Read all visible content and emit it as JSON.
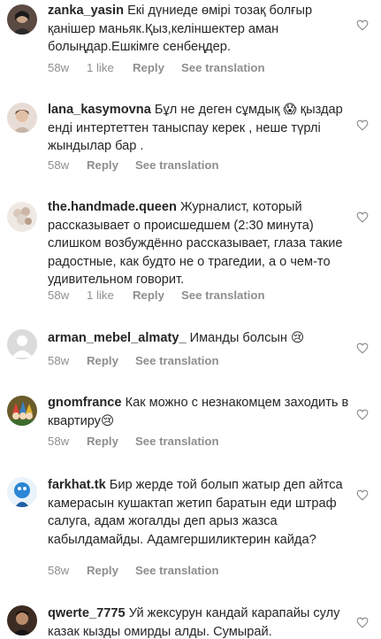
{
  "comments": [
    {
      "username": "zanka_yasin",
      "text": "Екі дүниеде өмірі тозақ болғыр қанішер маньяк.Қыз,келіншектер аман болыңдар.Ешкімге сенбеңдер.",
      "time": "58w",
      "likes": "1 like",
      "reply": "Reply",
      "translation": "See translation",
      "avatar": "avatar-woman-dark-hair"
    },
    {
      "username": "lana_kasymovna",
      "text": "Бұл не деген сұмдық 😱 қыздар енді интертеттен таныспау керек , неше түрлі жындылар бар .",
      "time": "58w",
      "likes": "",
      "reply": "Reply",
      "translation": "See translation",
      "avatar": "avatar-woman-light"
    },
    {
      "username": "the.handmade.queen",
      "text": "Журналист, который рассказывает о происшедшем (2:30 минута) слишком возбуждённо рассказывает, глаза такие радостные, как будто не о трагедии, а о чем-то удивительном говорит.",
      "time": "58w",
      "likes": "1 like",
      "reply": "Reply",
      "translation": "See translation",
      "avatar": "avatar-handmade-flowers"
    },
    {
      "username": "arman_mebel_almaty_",
      "text": "Иманды болсын 😢",
      "time": "58w",
      "likes": "",
      "reply": "Reply",
      "translation": "See translation",
      "avatar": "avatar-default-gray"
    },
    {
      "username": "gnomfrance",
      "text": "Как можно с незнакомцем заходить в квартиру😢",
      "time": "58w",
      "likes": "",
      "reply": "Reply",
      "translation": "See translation",
      "avatar": "avatar-gnomes"
    },
    {
      "username": "farkhat.tk",
      "text": "Бир жерде той болып жатыр деп айтса камерасын кушактап жетип баратын еди штраф салуга, адам жогалды деп арыз жазса кабылдамайды. Адамгершиликтерин кайда?",
      "time": "58w",
      "likes": "",
      "reply": "Reply",
      "translation": "See translation",
      "avatar": "avatar-blue-character"
    },
    {
      "username": "qwerte_7775",
      "text": "Уй жексурун кандай карапайы сулу казак кызды омирды алды. Сумырай.",
      "time": "",
      "likes": "",
      "reply": "",
      "translation": "",
      "avatar": "avatar-man-dark"
    }
  ],
  "colors": {
    "text": "#262626",
    "meta": "#8e8e8e",
    "heart": "#8e8e8e",
    "background": "#ffffff"
  },
  "icons": {
    "like": "heart-outline-icon"
  }
}
